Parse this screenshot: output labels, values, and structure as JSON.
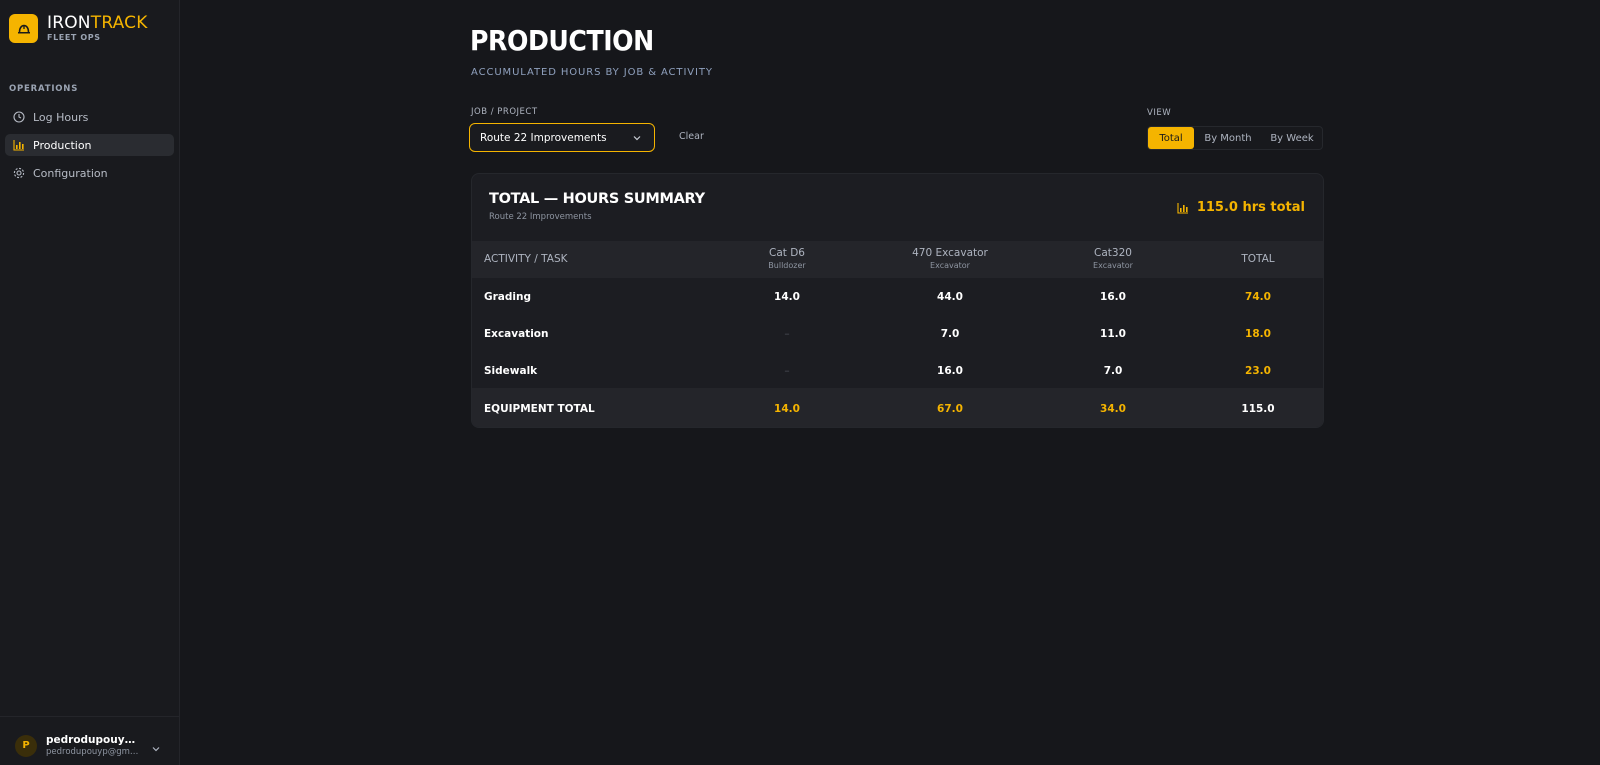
{
  "brand": {
    "name_part1": "IRON",
    "name_part2": "TRACK",
    "subtitle": "FLEET OPS",
    "accent": "#f5b400",
    "logo_icon": "hard-hat-icon"
  },
  "sidebar": {
    "section": "OPERATIONS",
    "items": [
      {
        "label": "Log Hours",
        "icon": "clock-icon",
        "active": false
      },
      {
        "label": "Production",
        "icon": "bar-chart-icon",
        "active": true
      },
      {
        "label": "Configuration",
        "icon": "gear-icon",
        "active": false
      }
    ],
    "user": {
      "initial": "P",
      "name": "pedrodupouyp@g...",
      "email": "pedrodupouyp@gmail..."
    }
  },
  "header": {
    "title": "PRODUCTION",
    "subtitle": "ACCUMULATED HOURS BY JOB & ACTIVITY"
  },
  "filters": {
    "job_label": "JOB / PROJECT",
    "job_value": "Route 22 Improvements",
    "clear_label": "Clear",
    "view_label": "VIEW",
    "view_options": [
      "Total",
      "By Month",
      "By Week"
    ],
    "view_selected": "Total"
  },
  "summary": {
    "title": "TOTAL — HOURS SUMMARY",
    "subtitle": "Route 22 Improvements",
    "total_text": "115.0 hrs total",
    "columns": {
      "activity": "ACTIVITY / TASK",
      "equipment": [
        {
          "name": "Cat D6",
          "type": "Bulldozer"
        },
        {
          "name": "470 Excavator",
          "type": "Excavator"
        },
        {
          "name": "Cat320",
          "type": "Excavator"
        }
      ],
      "total": "TOTAL"
    },
    "rows": [
      {
        "activity": "Grading",
        "values": [
          "14.0",
          "44.0",
          "16.0"
        ],
        "total": "74.0"
      },
      {
        "activity": "Excavation",
        "values": [
          "–",
          "7.0",
          "11.0"
        ],
        "total": "18.0"
      },
      {
        "activity": "Sidewalk",
        "values": [
          "–",
          "16.0",
          "7.0"
        ],
        "total": "23.0"
      }
    ],
    "footer": {
      "label": "EQUIPMENT TOTAL",
      "values": [
        "14.0",
        "67.0",
        "34.0"
      ],
      "total": "115.0"
    }
  }
}
